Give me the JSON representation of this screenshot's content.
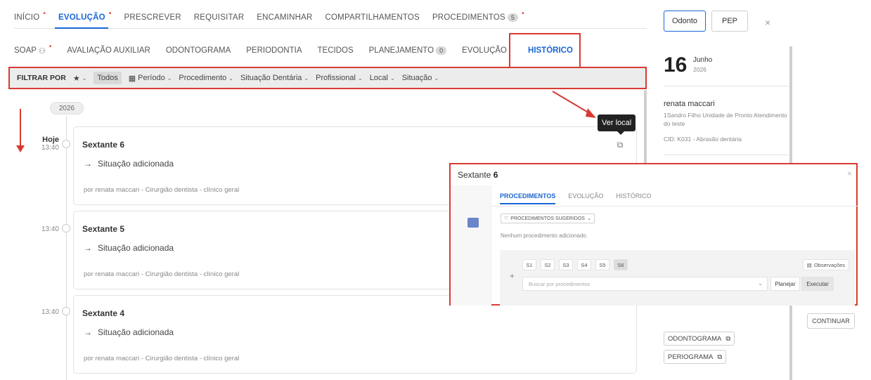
{
  "topnav": {
    "items": [
      {
        "label": "INÍCIO",
        "dot": "•"
      },
      {
        "label": "EVOLUÇÃO",
        "dot": "•"
      },
      {
        "label": "PRESCREVER"
      },
      {
        "label": "REQUISITAR"
      },
      {
        "label": "ENCAMINHAR"
      },
      {
        "label": "COMPARTILHAMENTOS"
      },
      {
        "label": "PROCEDIMENTOS",
        "count": "5",
        "dot": "•"
      }
    ]
  },
  "subnav": {
    "items": [
      {
        "label": "SOAP",
        "dot": "•"
      },
      {
        "label": "AVALIAÇÃO AUXILIAR"
      },
      {
        "label": "ODONTOGRAMA"
      },
      {
        "label": "PERIODONTIA"
      },
      {
        "label": "TECIDOS"
      },
      {
        "label": "PLANEJAMENTO",
        "count": "0"
      },
      {
        "label": "EVOLUÇÃO"
      },
      {
        "label": "HISTÓRICO"
      }
    ]
  },
  "filters": {
    "label": "FILTRAR POR",
    "todos": "Todos",
    "items": [
      "Período",
      "Procedimento",
      "Situação Dentária",
      "Profissional",
      "Local",
      "Situação"
    ]
  },
  "timeline": {
    "year": "2026",
    "today_label": "Hoje",
    "entries": [
      {
        "time": "13:40",
        "title": "Sextante 6",
        "action": "Situação adicionada",
        "by": "por renata maccari - Cirurgião dentista - clínico geral"
      },
      {
        "time": "13:40",
        "title": "Sextante 5",
        "action": "Situação adicionada",
        "by": "por renata maccari - Cirurgião dentista - clínico geral"
      },
      {
        "time": "13:40",
        "title": "Sextante 4",
        "action": "Situação adicionada",
        "by": "por renata maccari - Cirurgião dentista - clínico geral"
      }
    ]
  },
  "tooltip": {
    "text": "Ver local"
  },
  "sidepanel": {
    "btn_odonto": "Odonto",
    "btn_pep": "PEP",
    "close": "×",
    "day": "16",
    "month": "Junho",
    "year": "2026",
    "name": "renata maccari",
    "unit": "1Sandro Filho Unidade de Pronto Atendimento do teste",
    "cid": "CID: K031 - Abrasão dentária",
    "continuar": "CONTINUAR",
    "link_odontograma": "ODONTOGRAMA",
    "link_periograma": "PERIOGRAMA"
  },
  "modal": {
    "title_prefix": "Sextante",
    "title_number": "6",
    "close": "×",
    "tabs": [
      "PROCEDIMENTOS",
      "EVOLUÇÃO",
      "HISTÓRICO"
    ],
    "select_label": "PROCEDIMENTOS SUGERIDOS",
    "empty": "Nenhum procedimento adicionado.",
    "sextants": [
      "S1",
      "S2",
      "S3",
      "S4",
      "S5",
      "S6"
    ],
    "obs": "Observações",
    "search_placeholder": "Buscar por procedimentos",
    "planejar": "Planejar",
    "executar": "Executar"
  },
  "colors": {
    "accent": "#1a66d6",
    "highlight": "#d83a33"
  }
}
